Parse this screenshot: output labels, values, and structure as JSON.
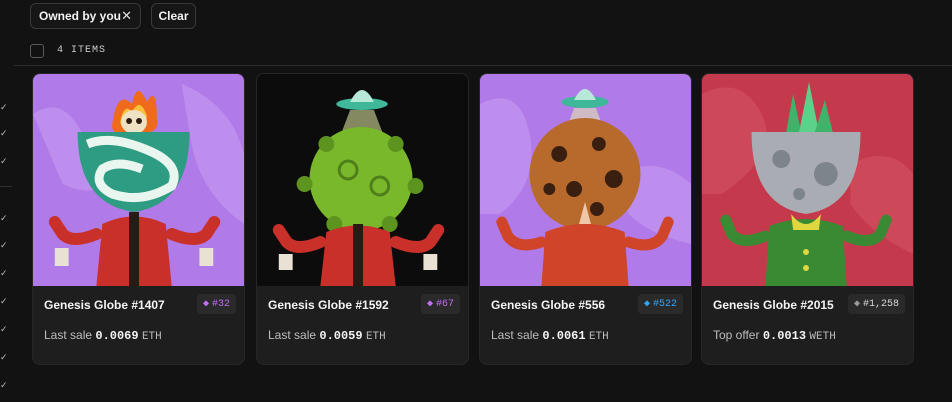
{
  "filters": {
    "owned_label": "Owned by you",
    "close_symbol": "✕",
    "clear_label": "Clear"
  },
  "items_count": "4 ITEMS",
  "cards": [
    {
      "title": "Genesis Globe #1407",
      "rank": "#32",
      "rank_color": "#c36cf0",
      "price_label": "Last sale",
      "price_value": "0.0069",
      "currency": "ETH",
      "bg": "#b07ae8"
    },
    {
      "title": "Genesis Globe #1592",
      "rank": "#67",
      "rank_color": "#c36cf0",
      "price_label": "Last sale",
      "price_value": "0.0059",
      "currency": "ETH",
      "bg": "#0c0c0c"
    },
    {
      "title": "Genesis Globe #556",
      "rank": "#522",
      "rank_color": "#2ea6ff",
      "price_label": "Last sale",
      "price_value": "0.0061",
      "currency": "ETH",
      "bg": "#b07ae8"
    },
    {
      "title": "Genesis Globe #2015",
      "rank": "#1,258",
      "rank_color": "#9a9a9a",
      "price_label": "Top offer",
      "price_value": "0.0013",
      "currency": "WETH",
      "bg": "#c43a4c"
    }
  ]
}
